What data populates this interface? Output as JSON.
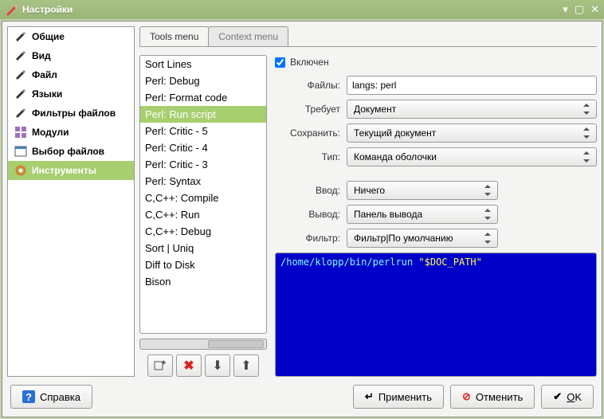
{
  "window": {
    "title": "Настройки"
  },
  "sidebar": {
    "items": [
      {
        "label": "Общие",
        "icon": "pencil"
      },
      {
        "label": "Вид",
        "icon": "pencil"
      },
      {
        "label": "Файл",
        "icon": "pencil"
      },
      {
        "label": "Языки",
        "icon": "pencil"
      },
      {
        "label": "Фильтры файлов",
        "icon": "pencil"
      },
      {
        "label": "Модули",
        "icon": "modules"
      },
      {
        "label": "Выбор файлов",
        "icon": "filesel"
      },
      {
        "label": "Инструменты",
        "icon": "gear",
        "selected": true
      }
    ]
  },
  "tabs": [
    {
      "label": "Tools menu",
      "active": true
    },
    {
      "label": "Context menu",
      "active": false
    }
  ],
  "tools_list": [
    "Sort Lines",
    "Perl: Debug",
    "Perl: Format code",
    "Perl: Run script",
    "Perl: Critic - 5",
    "Perl: Critic - 4",
    "Perl: Critic - 3",
    "Perl: Syntax",
    "C,C++: Compile",
    "C,C++: Run",
    "C,C++: Debug",
    "Sort | Uniq",
    "Diff to Disk",
    "Bison"
  ],
  "tools_selected_index": 3,
  "form": {
    "enabled_label": "Включен",
    "enabled": true,
    "files_label": "Файлы:",
    "files_value": "langs: perl",
    "requires_label": "Требует",
    "requires_value": "Документ",
    "save_label": "Сохранить:",
    "save_value": "Текущий документ",
    "type_label": "Тип:",
    "type_value": "Команда оболочки",
    "input_label": "Ввод:",
    "input_value": "Ничего",
    "output_label": "Вывод:",
    "output_value": "Панель вывода",
    "filter_label": "Фильтр:",
    "filter_value": "Фильтр|По умолчанию",
    "command_path": "/home/klopp/bin/perlrun ",
    "command_arg": "\"$DOC_PATH\""
  },
  "buttons": {
    "help": "Справка",
    "apply": "Применить",
    "cancel": "Отменить",
    "ok": "OK"
  },
  "tool_actions": {
    "add": "add-tool",
    "delete": "delete-tool",
    "down": "move-down",
    "up": "move-up"
  }
}
